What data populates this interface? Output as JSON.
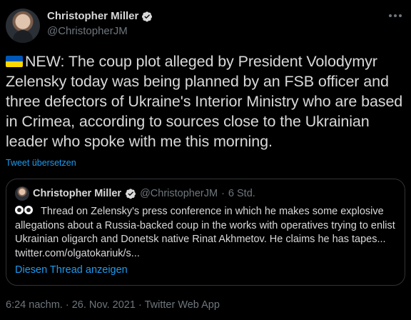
{
  "author": {
    "name": "Christopher Miller",
    "handle": "@ChristopherJM"
  },
  "tweet": {
    "text": "NEW: The coup plot alleged by President Volodymyr Zelensky today was being planned by an FSB officer and three defectors of Ukraine's Interior Ministry who are based in Crimea, according to sources close to the Ukrainian leader who spoke with me this morning.",
    "translate_label": "Tweet übersetzen"
  },
  "quoted_tweet": {
    "name": "Christopher Miller",
    "handle": "@ChristopherJM",
    "separator": "·",
    "age": "6 Std.",
    "text": "Thread on Zelensky's press conference in which he makes some explosive allegations about a Russia-backed coup in the works with operatives trying to enlist Ukrainian oligarch and Donetsk native Rinat Akhmetov. He claims he has tapes... twitter.com/olgatokariuk/s...",
    "show_thread_label": "Diesen Thread anzeigen"
  },
  "meta": {
    "time": "6:24 nachm.",
    "date": "26. Nov. 2021",
    "source": "Twitter Web App",
    "separator": "·"
  },
  "colors": {
    "background": "#000000",
    "text": "#d9d9d9",
    "secondary": "#6e767d",
    "link": "#1d9bf0",
    "border": "#2f3336"
  },
  "icons": {
    "verified": "verified-badge-icon",
    "more": "more-options-icon",
    "flag": "ukraine-flag-emoji",
    "eyes": "eyes-emoji"
  }
}
